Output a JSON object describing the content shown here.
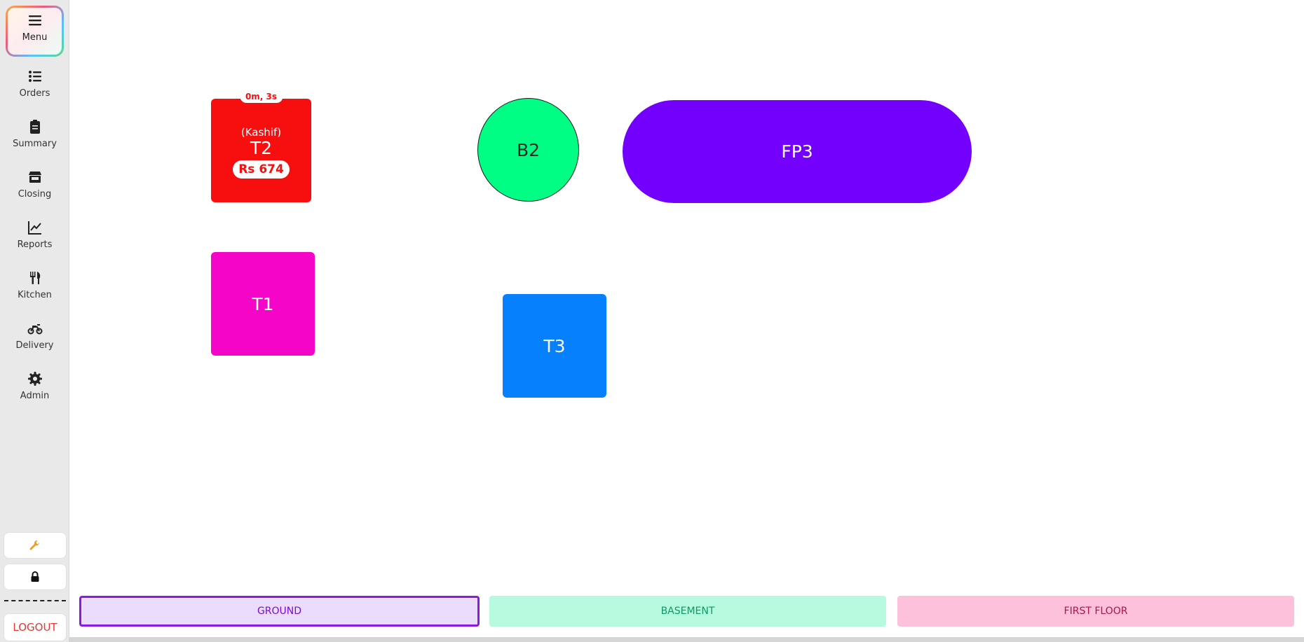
{
  "sidebar": {
    "menu_label": "Menu",
    "items": [
      {
        "label": "Orders",
        "icon": "list-icon"
      },
      {
        "label": "Summary",
        "icon": "clipboard-icon"
      },
      {
        "label": "Closing",
        "icon": "store-icon"
      },
      {
        "label": "Reports",
        "icon": "chart-line-icon"
      },
      {
        "label": "Kitchen",
        "icon": "utensils-icon"
      },
      {
        "label": "Delivery",
        "icon": "motorcycle-icon"
      },
      {
        "label": "Admin",
        "icon": "gear-icon"
      }
    ],
    "wrench_icon": "wrench-icon",
    "lock_icon": "lock-icon",
    "logout_label": "LOGOUT"
  },
  "tables": {
    "t2": {
      "name": "T2",
      "waiter": "(Kashif)",
      "amount": "Rs 674",
      "timer": "0m, 3s",
      "color": "#f70f0f"
    },
    "b2": {
      "name": "B2",
      "color": "#00fe85"
    },
    "fp3": {
      "name": "FP3",
      "color": "#7300fc"
    },
    "t1": {
      "name": "T1",
      "color": "#f505c7"
    },
    "t3": {
      "name": "T3",
      "color": "#0680fc"
    }
  },
  "floors": {
    "ground": "GROUND",
    "basement": "BASEMENT",
    "first_floor": "FIRST FLOOR",
    "active": "ground"
  },
  "colors": {
    "accent": "#7b0bd6",
    "logout": "#e53935"
  }
}
